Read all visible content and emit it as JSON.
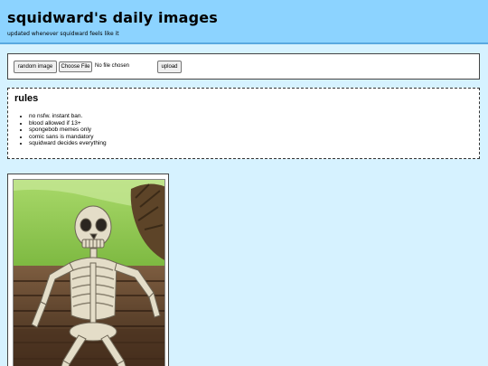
{
  "header": {
    "title": "squidward's daily images",
    "subtitle": "updated whenever squidward feels like it"
  },
  "upload": {
    "random_label": "random image",
    "choose_label": "Choose File",
    "file_status": "No file chosen",
    "upload_label": "upload"
  },
  "rules": {
    "title": "rules",
    "items": [
      "no nsfw. instant ban.",
      "blood allowed if 13+",
      "spongebob memes only",
      "comic sans is mandatory",
      "squidward decides everything"
    ]
  },
  "image": {
    "subject": "skeleton-on-bench"
  }
}
